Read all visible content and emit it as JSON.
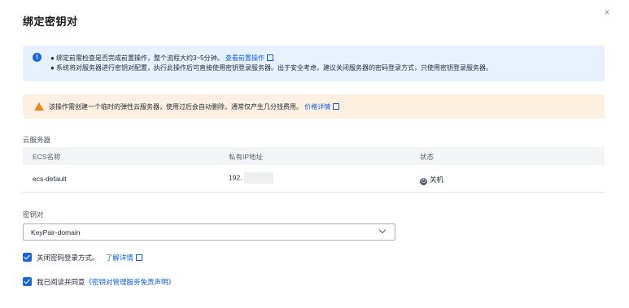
{
  "dialog": {
    "title": "绑定密钥对",
    "close_glyph": "×"
  },
  "info": {
    "line1_text": "● 绑定前需检查是否完成前置操作，整个流程大约3~5分钟。",
    "line1_link": "查看前置操作",
    "line2_text": "● 系统将对服务器进行密钥对配置，执行此操作后可直接使用密钥登录服务器。出于安全考虑，建议关闭服务器的密码登录方式，只使用密钥登录服务器。"
  },
  "warning": {
    "text": "该操作需创建一个临时的弹性云服务器，使用过后会自动删除，通常仅产生几分钱费用。",
    "link": "价格详情"
  },
  "servers": {
    "label": "云服务器",
    "columns": [
      "ECS名称",
      "私有IP地址",
      "状态"
    ],
    "rows": [
      {
        "name": "ecs-default",
        "ip_prefix": "192.",
        "status": "关机"
      }
    ]
  },
  "keypair": {
    "label": "密钥对",
    "selected": "KeyPair-domain"
  },
  "options": {
    "disable_password_label": "关闭密码登录方式。",
    "disable_password_link": "了解详情",
    "agree_label": "我已阅读并同意",
    "agree_link": "《密钥对管理服务免责声明》"
  },
  "colors": {
    "primary": "#1a66d8",
    "link": "#0f5fe0",
    "info_bg": "#e6f1fd",
    "warn_bg": "#fdf0e1",
    "warn_icon": "#e9891a"
  }
}
